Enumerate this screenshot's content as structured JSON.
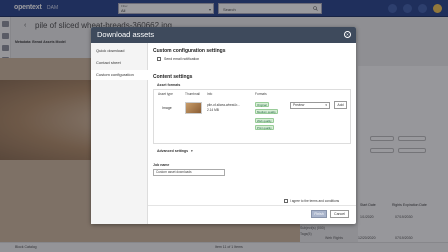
{
  "app": {
    "brand": "opentext",
    "product": "DAM",
    "filter": {
      "label": "Filter",
      "value": "All"
    },
    "search": {
      "placeholder": "Search"
    },
    "page_title": "pile of sliced wheat-breads-360662.jpg",
    "tab_label": "Metadata: Bread Assets Model",
    "status_left": "Block Catalog",
    "status_center": "Item 11 of 1 Items"
  },
  "right_panel": {
    "columns": [
      "Start Date",
      "Rights Expiration Date"
    ],
    "rows": [
      {
        "left": "1/1/2020",
        "right": "07/19/2030"
      },
      {
        "left": "12/20/2020",
        "right": "07/19/2030"
      }
    ],
    "ghost_texts": [
      "Subject(s) (000)",
      "Web Rights",
      "Tags(5)"
    ]
  },
  "modal": {
    "title": "Download assets",
    "nav": [
      {
        "label": "Quick download",
        "active": false
      },
      {
        "label": "Contact sheet",
        "active": false
      },
      {
        "label": "Custom configuration",
        "active": true
      }
    ],
    "custom_title": "Custom configuration settings",
    "send_email_label": "Send email notification",
    "content_title": "Content settings",
    "asset_formats_label": "Asset formats",
    "table": {
      "headers": [
        "Asset type",
        "Thumbnail",
        "Info",
        "Formats"
      ],
      "row": {
        "asset_type": "Image",
        "info_line1": "pile-of-slicea-wheat-b...",
        "info_line2": "2.14 MB",
        "formats": [
          "Original",
          "Medium quality",
          "Web quality",
          "Print quality"
        ],
        "select_value": "Preview",
        "add_label": "Add"
      }
    },
    "advanced_label": "Advanced settings",
    "job_name_label": "Job name",
    "job_name_value": "Custom asset downloads",
    "terms_label": "I agree to the terms and conditions",
    "finish_label": "Finish",
    "cancel_label": "Cancel"
  },
  "colors": {
    "brand_bar": "#1f3c88",
    "modal_header": "#3e4a5c",
    "pill_green": "#d8efd6"
  }
}
